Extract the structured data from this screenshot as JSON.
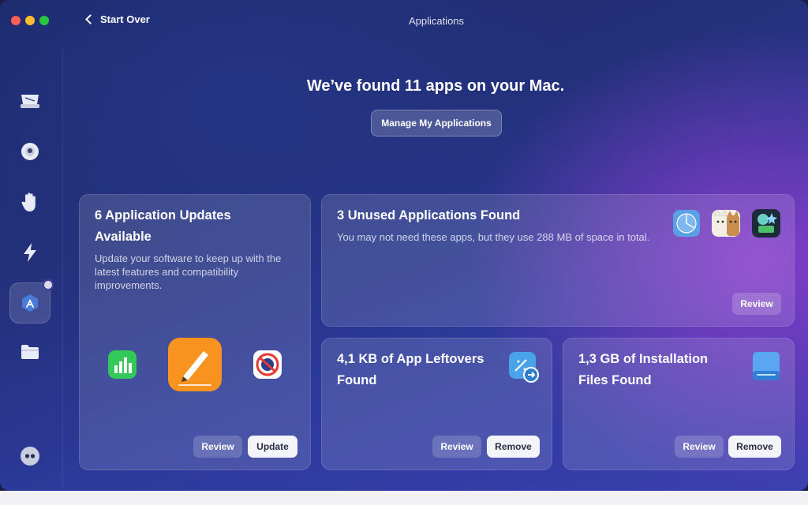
{
  "window": {
    "title": "Applications"
  },
  "nav": {
    "back_label": "Start Over"
  },
  "sidebar": {
    "items": [
      {
        "name": "cleanup",
        "icon": "disk-cleanup-icon"
      },
      {
        "name": "protection",
        "icon": "shield-dot-icon"
      },
      {
        "name": "privacy",
        "icon": "hand-icon"
      },
      {
        "name": "performance",
        "icon": "lightning-icon"
      },
      {
        "name": "applications",
        "icon": "app-store-icon",
        "active": true
      },
      {
        "name": "files",
        "icon": "folder-icon"
      }
    ],
    "bottom_icon": "assistant-icon"
  },
  "hero": {
    "headline": "We’ve found 11 apps on your Mac.",
    "manage_label": "Manage My Applications"
  },
  "cards": {
    "updates": {
      "title": "6 Application Updates Available",
      "description": "Update your software to keep up with the latest features and compatibility improvements.",
      "review_label": "Review",
      "update_label": "Update",
      "icons": [
        "numbers-icon",
        "pages-icon",
        "blocker-icon"
      ]
    },
    "unused": {
      "title": "3 Unused Applications Found",
      "description": "You may not need these apps, but they use 288 MB of space in total.",
      "review_label": "Review",
      "icons": [
        "safari-like-icon",
        "cats-icon",
        "money-app-icon"
      ]
    },
    "leftovers": {
      "title": "4,1 KB of App Leftovers Found",
      "review_label": "Review",
      "remove_label": "Remove",
      "icon": "leftovers-icon"
    },
    "installation": {
      "title": "1,3 GB of Installation Files Found",
      "review_label": "Review",
      "remove_label": "Remove",
      "icon": "installer-disk-icon"
    }
  },
  "colors": {
    "accent_orange": "#f7931e",
    "numbers_green": "#34c759",
    "button_white": "#f4f5fa"
  }
}
